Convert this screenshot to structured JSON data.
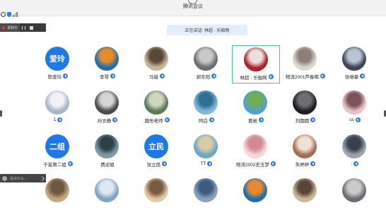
{
  "window": {
    "title": "腾讯会议"
  },
  "recording": {
    "label": "录制中"
  },
  "speaking": {
    "text": "正在讲话: 林超 - 乐舶网"
  },
  "chat": {
    "placeholder": "说点什么..."
  },
  "colors": {
    "accent": "#2f7be5",
    "active_border": "#4cc08a",
    "text_avatar_bg": "#1f78e8"
  },
  "participants": [
    {
      "name": "陈爱玲",
      "avatar_text": "爱玲",
      "mic": true
    },
    {
      "name": "李琴",
      "avatar_text": "",
      "mic": true
    },
    {
      "name": "马骏",
      "avatar_text": "",
      "mic": true
    },
    {
      "name": "郭东阳",
      "avatar_text": "",
      "mic": true
    },
    {
      "name": "林超 - 乐舶网",
      "avatar_text": "",
      "mic": true,
      "active": true
    },
    {
      "name": "物流2001芦春晖",
      "avatar_text": "",
      "mic": true
    },
    {
      "name": "张维豪",
      "avatar_text": "",
      "mic": true
    },
    {
      "name": "1",
      "avatar_text": "",
      "mic": true
    },
    {
      "name": "孙文静",
      "avatar_text": "",
      "mic": true
    },
    {
      "name": "聂彤老师",
      "avatar_text": "",
      "mic": true
    },
    {
      "name": "阿白",
      "avatar_text": "",
      "mic": true
    },
    {
      "name": "葛岩",
      "avatar_text": "",
      "mic": true
    },
    {
      "name": "刘圆圆",
      "avatar_text": "",
      "mic": true
    },
    {
      "name": "ss",
      "avatar_text": "",
      "mic": true
    },
    {
      "name": "于芸第二组",
      "avatar_text": "二组",
      "mic": true
    },
    {
      "name": "费迎姐",
      "avatar_text": "",
      "mic": false
    },
    {
      "name": "张立民",
      "avatar_text": "立民",
      "mic": true
    },
    {
      "name": "TT",
      "avatar_text": "",
      "mic": true
    },
    {
      "name": "物流2002史玉梦",
      "avatar_text": "",
      "mic": true
    },
    {
      "name": "朱婷婷",
      "avatar_text": "",
      "mic": true
    },
    {
      "name": ".",
      "avatar_text": "",
      "mic": true
    },
    {
      "name": "",
      "avatar_text": "",
      "mic": false
    },
    {
      "name": "",
      "avatar_text": "",
      "mic": false
    },
    {
      "name": "",
      "avatar_text": "",
      "mic": false
    },
    {
      "name": "",
      "avatar_text": "",
      "mic": false
    },
    {
      "name": "",
      "avatar_text": "",
      "mic": false
    },
    {
      "name": "",
      "avatar_text": "",
      "mic": false
    },
    {
      "name": "",
      "avatar_text": "",
      "mic": false
    }
  ]
}
